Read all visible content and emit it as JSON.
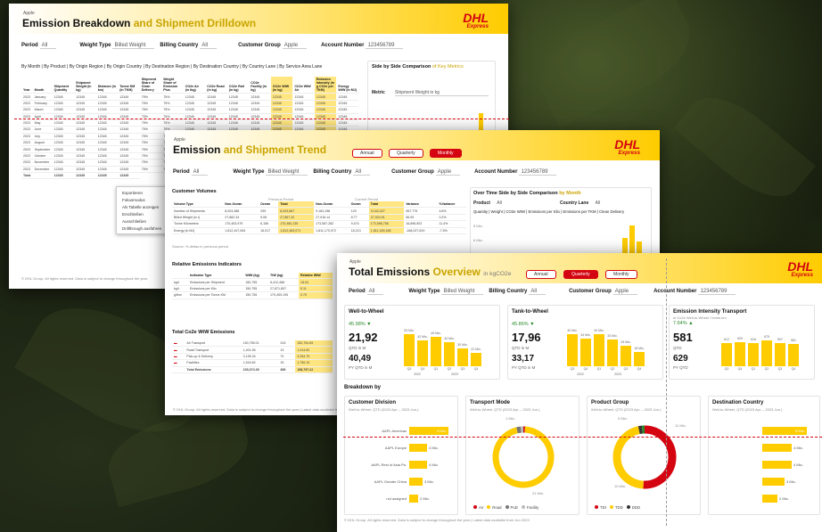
{
  "r1": {
    "company": "Apple",
    "title_main": "Emission Breakdown",
    "title_sub": "and Shipment Drilldown",
    "brand": "DHL",
    "brand_sub": "Express",
    "filters": [
      {
        "label": "Period",
        "value": "All"
      },
      {
        "label": "Weight Type",
        "value": "Billed Weight"
      },
      {
        "label": "Billing Country",
        "value": "All"
      },
      {
        "label": "Customer Group",
        "value": "Apple"
      },
      {
        "label": "Account Number",
        "value": "123456789"
      }
    ],
    "tabs": "By Month | By Product | By Origin Region | By Origin Country | By Destination Region | By Destination Country | By Country Lane | By Service Area Lane",
    "columns": [
      "Year",
      "Month",
      "Shipment Quantity",
      "Shipment Weight (in kg)",
      "Distance (in km)",
      "Tonne KM (in TKM)",
      "Shipment Share of Clean Delivery",
      "Weight Share of Emission Plus",
      "CO2e Air (in tkg)",
      "CO2e Road (in kg)",
      "CO2e Rail (in kg)",
      "CO2e Facility (in kg)",
      "CO2e WtW (in kg)",
      "CO2e WtW Air",
      "Emission Intensity (in g CO2e per TKM)",
      "Energy WtW (in MJ)"
    ],
    "rows": [
      [
        "2023",
        "January",
        "12345",
        "12345",
        "12345",
        "12345",
        "75%",
        "75%",
        "12345",
        "12345",
        "12345",
        "12345",
        "12345",
        "12345",
        "12345",
        "12345"
      ],
      [
        "2023",
        "February",
        "12345",
        "12345",
        "12345",
        "12345",
        "75%",
        "75%",
        "12345",
        "12345",
        "12345",
        "12345",
        "12345",
        "12345",
        "12345",
        "12345"
      ],
      [
        "2023",
        "March",
        "12345",
        "12345",
        "12345",
        "12345",
        "75%",
        "75%",
        "12345",
        "12345",
        "12345",
        "12345",
        "12345",
        "12345",
        "12345",
        "12345"
      ],
      [
        "2023",
        "April",
        "12345",
        "12345",
        "12345",
        "12345",
        "75%",
        "75%",
        "12345",
        "12345",
        "12345",
        "12345",
        "12345",
        "12345",
        "12345",
        "12345"
      ],
      [
        "2023",
        "May",
        "12345",
        "12345",
        "12345",
        "12345",
        "75%",
        "75%",
        "12345",
        "12345",
        "12345",
        "12345",
        "12345",
        "12345",
        "12345",
        "12345"
      ],
      [
        "2023",
        "June",
        "12345",
        "12345",
        "12345",
        "12345",
        "75%",
        "75%",
        "12345",
        "12345",
        "12345",
        "12345",
        "12345",
        "12345",
        "12345",
        "12345"
      ],
      [
        "2023",
        "July",
        "12345",
        "12345",
        "12345",
        "12345",
        "75%",
        "75%",
        "12345",
        "12345",
        "12345",
        "12345",
        "12345",
        "12345",
        "12345",
        "12345"
      ],
      [
        "2023",
        "August",
        "12345",
        "12345",
        "12345",
        "12345",
        "75%",
        "75%",
        "",
        "",
        "",
        "",
        "",
        "",
        "",
        ""
      ],
      [
        "2023",
        "September",
        "12345",
        "12345",
        "12345",
        "12345",
        "75%",
        "75%",
        "",
        "",
        "",
        "",
        "",
        "",
        "",
        ""
      ],
      [
        "2023",
        "October",
        "12345",
        "12345",
        "12345",
        "12345",
        "75%",
        "75%",
        "",
        "",
        "",
        "",
        "",
        "",
        "",
        ""
      ],
      [
        "2023",
        "November",
        "12345",
        "12345",
        "12345",
        "12345",
        "75%",
        "75%",
        "",
        "",
        "",
        "",
        "",
        "",
        "",
        ""
      ],
      [
        "2023",
        "December",
        "12345",
        "12345",
        "12345",
        "12345",
        "75%",
        "75%",
        "",
        "",
        "",
        "",
        "",
        "",
        "",
        ""
      ]
    ],
    "total_label": "Total",
    "total_row": [
      "12345",
      "12345",
      "12345",
      "12345"
    ],
    "context_menu": [
      "Exportieren",
      "Fokusmodus",
      "Als Tabelle anzeigen",
      "Erschließen",
      "Ausschließen",
      "Drillthrough ausführen"
    ],
    "side_title": "Side by Side Comparison",
    "side_title_sub": "of Key Metrics",
    "metric_label": "Metric",
    "metric_value": "Shipment Weight in kg",
    "footer": "© DHL Group. All rights reserved. Data is subject to change throughout the year."
  },
  "r2": {
    "company": "Apple",
    "title_main": "Emission",
    "title_sub": "and Shipment Trend",
    "brand": "DHL",
    "brand_sub": "Express",
    "toggle": [
      "Annual",
      "Quarterly",
      "Monthly"
    ],
    "filters": [
      {
        "label": "Period",
        "value": "All"
      },
      {
        "label": "Weight Type",
        "value": "Billed Weight"
      },
      {
        "label": "Billing Country",
        "value": "All"
      },
      {
        "label": "Customer Group",
        "value": "Apple"
      },
      {
        "label": "Account Number",
        "value": "123456789"
      }
    ],
    "volumes_title": "Customer Volumes",
    "prev_period": "Previous Period",
    "curr_period": "Current Period",
    "vol_columns": [
      "Volume Type",
      "Non-Ocean",
      "Ocean",
      "Total",
      "Non-Ocean",
      "Ocean",
      "Total",
      "Variance",
      "%Variance"
    ],
    "vol_rows": [
      [
        "Number of Shipments",
        "8,003,388",
        "299",
        "8,003,687",
        "9,163,198",
        "129",
        "9,163,327",
        "557,775",
        "4.8%"
      ],
      [
        "Billed Weight (in t)",
        "27,862.34",
        "5.08",
        "27,867.42",
        "27,916.14",
        "8.77",
        "27,924.91",
        "56.99",
        "0.2%"
      ],
      [
        "Tonne Kilometers",
        "170,453,979",
        "6,156",
        "170,460,135",
        "173,587,282",
        "9,474",
        "173,596,756",
        "16,896,503",
        "11.4%"
      ],
      [
        "Energy (in MJ)",
        "1,812,447,054",
        "16,017",
        "1,812,463,071",
        "1,811,170,972",
        "18,213",
        "1,811,189,185",
        "-168,027,819",
        "-7.5%"
      ]
    ],
    "vol_note": "Source: % deltas in previous period",
    "rel_title": "Relative Emissions Indicators",
    "rel_columns": [
      "Indicator Type",
      "WtW (kg)",
      "TtW (kg)",
      "Relative WtW"
    ],
    "rel_rows": [
      [
        "kg/t",
        "Emissions per Shipment",
        "150,755",
        "8,412,468",
        "18.04"
      ],
      [
        "kg/t",
        "Emissions per Kilo",
        "150,755",
        "27,871,807",
        "5.11"
      ],
      [
        "g/tkm",
        "Emissions per Tonne-KM",
        "150,755",
        "170,459,195",
        "0.70"
      ]
    ],
    "wtw_title": "Total Co2e WtW Emissions",
    "wtw_rows": [
      [
        "Air Transport",
        "150,755.01",
        "315",
        "150,754.69"
      ],
      [
        "Road Transport",
        "1,401.55",
        "13",
        "1,414.60"
      ],
      [
        "Pick-up & Delivery",
        "3,195.34",
        "70",
        "3,254.79"
      ],
      [
        "Facilities",
        "1,516.82",
        "15",
        "1,796.10"
      ]
    ],
    "wtw_total": [
      "Total Emissions",
      "153,074.39",
      "389",
      "158,797.22"
    ],
    "trend_title": "Over Time Side by Side Comparison",
    "trend_title_sub": "by Month",
    "product_label": "Product",
    "product_value": "All",
    "lane_label": "Country Lane",
    "lane_value": "All",
    "metric_strip": "Quantity | Weight | CO2e WtW | Emissions per Kilo | Emissions per TKM | Clean Delivery",
    "y_ticks": [
      "8 Mio.",
      "6 Mio."
    ],
    "footer": "© DHL Group. All rights reserved. Data is subject to change throughout the year | Latest data available from"
  },
  "r3": {
    "company": "Apple",
    "title_main": "Total Emissions",
    "title_sub": "Overview",
    "title_unit": "in kgCO2e",
    "brand": "DHL",
    "brand_sub": "Express",
    "toggle": [
      "Annual",
      "Quarterly",
      "Monthly"
    ],
    "filters": [
      {
        "label": "Period",
        "value": "All"
      },
      {
        "label": "Weight Type",
        "value": "Billed Weight"
      },
      {
        "label": "Billing Country",
        "value": "All"
      },
      {
        "label": "Customer Group",
        "value": "Apple"
      },
      {
        "label": "Account Number",
        "value": "123456789"
      }
    ],
    "kpis": [
      {
        "title": "Well-to-Wheel",
        "pct": "45.98% ▼",
        "value": "21,92",
        "value_label": "QTD in M",
        "prev": "40,49",
        "prev_label": "PY QTD in M",
        "bars": [
          {
            "label": "Q3",
            "value": 53,
            "text": "53 Mio."
          },
          {
            "label": "Q4",
            "value": 42,
            "text": "42 Mio."
          },
          {
            "label": "Q1",
            "value": 49,
            "text": "49 Mio."
          },
          {
            "label": "Q2",
            "value": 40,
            "text": "40 Mio."
          },
          {
            "label": "Q3",
            "value": 30,
            "text": "30 Mio."
          },
          {
            "label": "Q4",
            "value": 22,
            "text": "22 Mio."
          }
        ]
      },
      {
        "title": "Tank-to-Wheel",
        "pct": "45.86% ▼",
        "value": "17,96",
        "value_label": "QTD in M",
        "prev": "33,17",
        "prev_label": "PY QTD in M",
        "bars": [
          {
            "label": "Q3",
            "value": 40,
            "text": "40 Mio."
          },
          {
            "label": "Q4",
            "value": 34,
            "text": "34 Mio."
          },
          {
            "label": "Q1",
            "value": 40,
            "text": "40 Mio."
          },
          {
            "label": "Q2",
            "value": 33,
            "text": "33 Mio."
          },
          {
            "label": "Q3",
            "value": 25,
            "text": "25 Mio."
          },
          {
            "label": "Q4",
            "value": 18,
            "text": "18 Mio."
          }
        ]
      },
      {
        "title": "Emission Intensity Transport",
        "subtitle": "in Co2e Well-to-Wheel / tonne.km",
        "pct": "7.64% ▲",
        "value": "581",
        "value_label": "QTD",
        "prev": "629",
        "prev_label": "PY QTD",
        "bars": [
          {
            "label": "Q3",
            "value": 612,
            "text": "612"
          },
          {
            "label": "Q4",
            "value": 629,
            "text": "629"
          },
          {
            "label": "Q1",
            "value": 616,
            "text": "616"
          },
          {
            "label": "Q2",
            "value": 675,
            "text": "675"
          },
          {
            "label": "Q3",
            "value": 597,
            "text": "597"
          },
          {
            "label": "Q4",
            "value": 581,
            "text": "581"
          }
        ]
      }
    ],
    "year_labels": [
      "2022",
      "2023"
    ],
    "breakdown_title": "Breakdown by",
    "cards": [
      {
        "title": "Customer Division",
        "subtitle": "Well-to-Wheel, QTD (2023 Apr. – 2023 Jun.)",
        "rows": [
          {
            "label": "AAPL Americas",
            "value": 9,
            "text": "9 Mio."
          },
          {
            "label": "AAPL Europe",
            "value": 4,
            "text": "4 Mio."
          },
          {
            "label": "AAPL Rest of Asia Pa.",
            "value": 4,
            "text": "4 Mio."
          },
          {
            "label": "AAPL Greater China",
            "value": 3,
            "text": "3 Mio."
          },
          {
            "label": "not assigned",
            "value": 2,
            "text": "2 Mio."
          }
        ]
      },
      {
        "title": "Transport Mode",
        "subtitle": "Well-to-Wheel, QTD (2023 Apr. – 2023 Jun.)",
        "slices": [
          {
            "name": "Air",
            "value": 0.2,
            "color": "#d40511"
          },
          {
            "name": "Road",
            "value": 21,
            "color": "#ffcc00"
          },
          {
            "name": "PuD",
            "value": 0.5,
            "color": "#777777"
          },
          {
            "name": "Facility",
            "value": 0.3,
            "color": "#bbbbbb"
          }
        ],
        "labels": [
          "1 Mio.",
          "21 Mio."
        ]
      },
      {
        "title": "Product Group",
        "subtitle": "Well-to-Wheel, QTD (2023 Apr. – 2023 Jun.)",
        "slices": [
          {
            "name": "TDI",
            "value": 11,
            "color": "#d40511"
          },
          {
            "name": "TDD",
            "value": 10,
            "color": "#ffcc00"
          },
          {
            "name": "DDD",
            "value": 0.4,
            "color": "#333333"
          },
          {
            "name": "Other",
            "value": 0.3,
            "color": "#2a8a2a"
          }
        ],
        "labels": [
          "0 Mio.",
          "11 Mio.",
          "10 Mio."
        ]
      },
      {
        "title": "Destination Country",
        "subtitle": "Well-to-Wheel, QTD (2023 Apr. – 2023 Jun.)",
        "rows": [
          {
            "label": "",
            "value": 6,
            "text": "6 Mio."
          },
          {
            "label": "",
            "value": 4,
            "text": "4 Mio."
          },
          {
            "label": "",
            "value": 4,
            "text": "4 Mio."
          },
          {
            "label": "",
            "value": 3,
            "text": "3 Mio."
          },
          {
            "label": "",
            "value": 2,
            "text": "2 Mio."
          }
        ]
      }
    ],
    "footer": "© DHL Group. All rights reserved. Data is subject to change throughout the year | Latest data available from",
    "footer_date": "Jun 2023"
  }
}
